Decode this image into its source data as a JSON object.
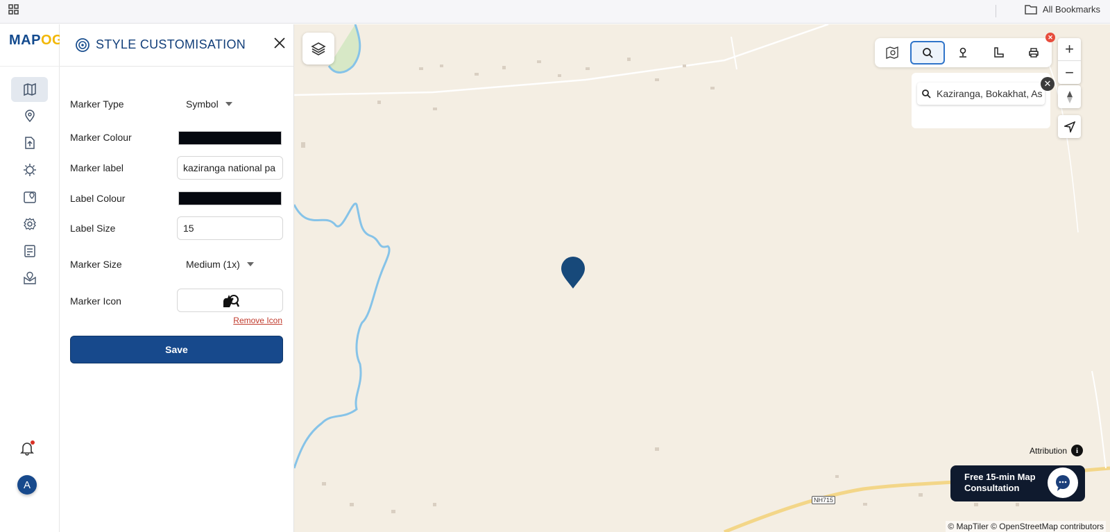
{
  "browser": {
    "apps_icon": "apps-grid-icon",
    "bookmarks_label": "All Bookmarks"
  },
  "rail": {
    "logo_main": "MAP",
    "logo_accent": "OG",
    "items": [
      {
        "name": "map-icon"
      },
      {
        "name": "location-pin-icon"
      },
      {
        "name": "upload-icon"
      },
      {
        "name": "sun-icon"
      },
      {
        "name": "map-pin-area-icon"
      },
      {
        "name": "settings-icon"
      },
      {
        "name": "checklist-icon"
      },
      {
        "name": "map-marker-icon"
      }
    ],
    "avatar_initial": "A"
  },
  "panel": {
    "title": "STYLE CUSTOMISATION",
    "marker_type_label": "Marker Type",
    "marker_type_value": "Symbol",
    "marker_colour_label": "Marker Colour",
    "marker_colour_value": "#05080f",
    "marker_label_label": "Marker label",
    "marker_label_value": "kaziranga national pa",
    "label_colour_label": "Label Colour",
    "label_colour_value": "#05080f",
    "label_size_label": "Label Size",
    "label_size_value": "15",
    "marker_size_label": "Marker Size",
    "marker_size_value": "Medium (1x)",
    "marker_icon_label": "Marker Icon",
    "remove_icon_label": "Remove Icon",
    "save_label": "Save"
  },
  "map": {
    "search_value": "Kaziranga, Bokakhat, As",
    "attribution_label": "Attribution",
    "consult_line1": "Free 15-min Map",
    "consult_line2": "Consultation",
    "credits": "© MapTiler © OpenStreetMap contributors",
    "road_label": "NH715",
    "marker_color": "#17497a"
  }
}
